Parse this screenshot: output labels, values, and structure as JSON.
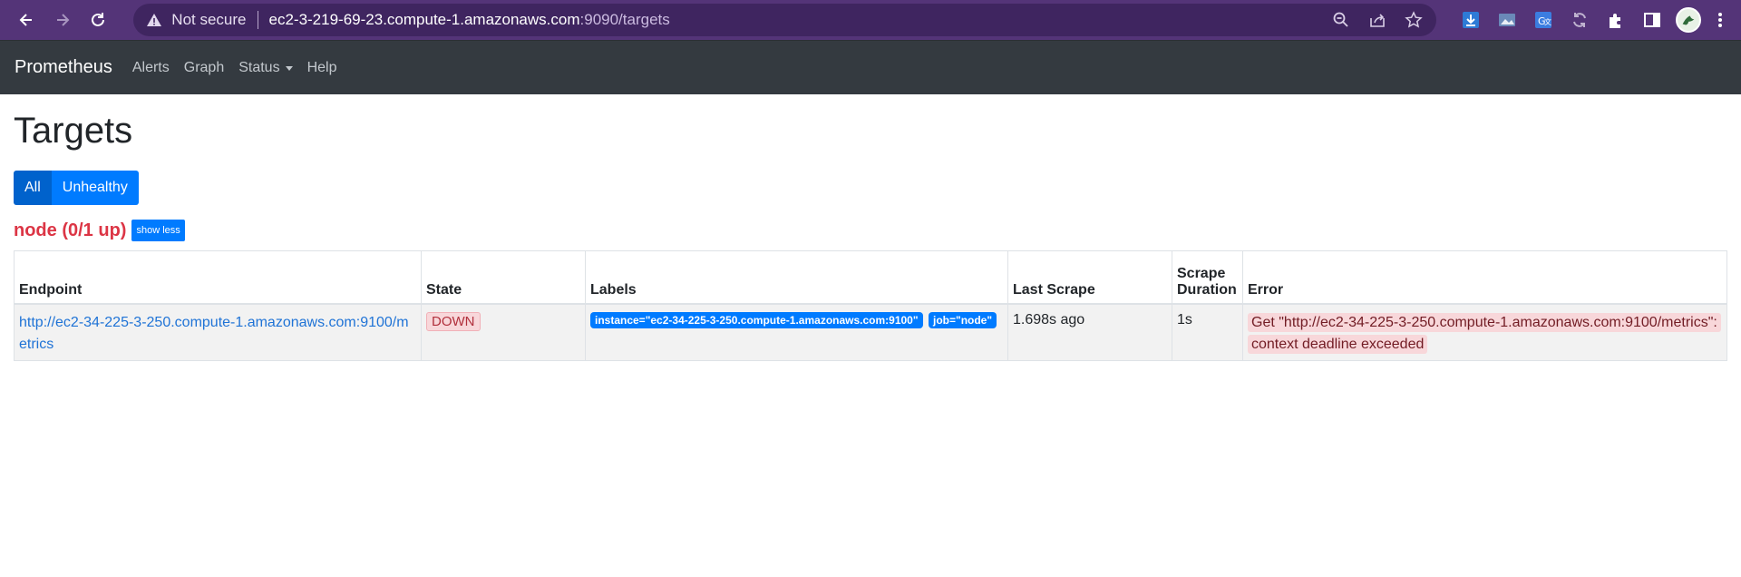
{
  "browser": {
    "not_secure_label": "Not secure",
    "url_host": "ec2-3-219-69-23.compute-1.amazonaws.com",
    "url_path": ":9090/targets",
    "icons": [
      "back-icon",
      "forward-icon",
      "reload-icon",
      "warning-icon",
      "zoom-icon",
      "share-icon",
      "star-icon",
      "download-extension-icon",
      "image-extension-icon",
      "translate-extension-icon",
      "sync-extension-icon",
      "puzzle-icon",
      "sidepanel-icon",
      "avatar",
      "kebab-menu-icon"
    ],
    "colors": {
      "frame": "#543478",
      "omnibox": "#3f2560"
    }
  },
  "navbar": {
    "brand": "Prometheus",
    "links": {
      "alerts": "Alerts",
      "graph": "Graph",
      "status": "Status",
      "help": "Help"
    },
    "color": "#343a40"
  },
  "page": {
    "title": "Targets",
    "filters": {
      "all": "All",
      "unhealthy": "Unhealthy",
      "active": "All"
    }
  },
  "job": {
    "title": "node (0/1 up)",
    "toggle_label": "show less",
    "table": {
      "headers": {
        "endpoint": "Endpoint",
        "state": "State",
        "labels": "Labels",
        "last_scrape": "Last Scrape",
        "scrape_duration_line1": "Scrape",
        "scrape_duration_line2": "Duration",
        "error": "Error"
      },
      "rows": [
        {
          "endpoint": "http://ec2-34-225-3-250.compute-1.amazonaws.com:9100/metrics",
          "state": "DOWN",
          "labels": [
            "instance=\"ec2-34-225-3-250.compute-1.amazonaws.com:9100\"",
            "job=\"node\""
          ],
          "last_scrape": "1.698s ago",
          "scrape_duration": "1s",
          "error": "Get \"http://ec2-34-225-3-250.compute-1.amazonaws.com:9100/metrics\": context deadline exceeded"
        }
      ]
    },
    "colors": {
      "down": "#dc3545",
      "label": "#007bff",
      "link": "#1f73d6"
    }
  }
}
